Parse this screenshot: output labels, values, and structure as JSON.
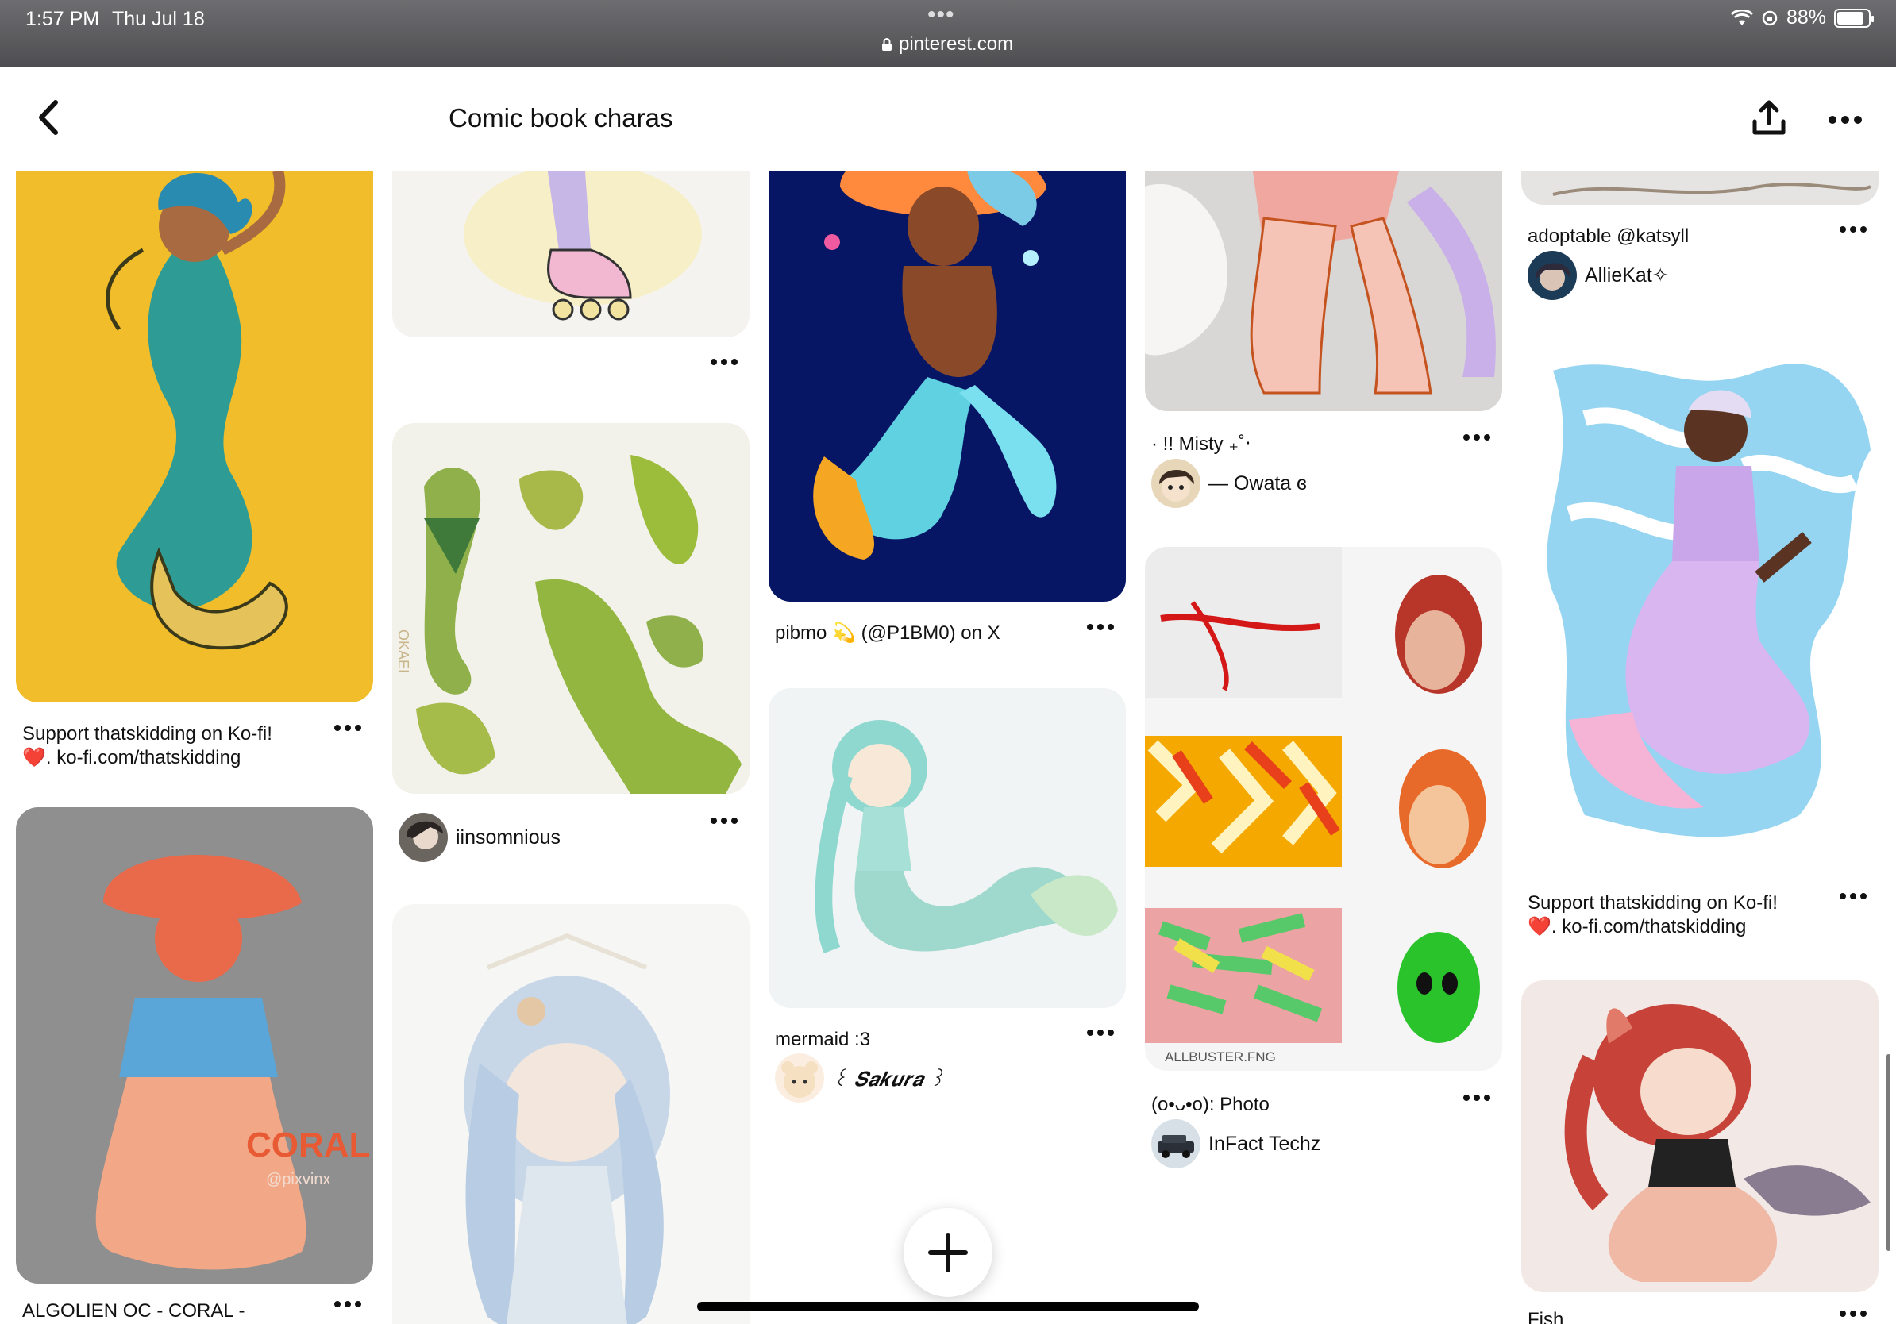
{
  "status": {
    "time": "1:57 PM",
    "date": "Thu Jul 18",
    "url": "pinterest.com",
    "battery": "88%",
    "battery_level": 0.88
  },
  "header": {
    "title": "Comic book charas"
  },
  "pins": {
    "col1": [
      {
        "title_line1": "Support thatskidding on Ko-fi!",
        "title_line2": "❤️. ko-fi.com/thatskidding"
      },
      {
        "title_line1": "ALGOLIEN OC - CORAL -",
        "image_text1": "CORAL",
        "image_text2": "@pixvinx"
      }
    ],
    "col2": [
      {
        "title_line1": ""
      },
      {
        "author": "iinsomnious",
        "image_text": "OKAEI"
      },
      {
        "title_line1": ""
      }
    ],
    "col3": [
      {
        "title_line1": "pibmo 💫 (@P1BM0) on X"
      },
      {
        "title_line1": "mermaid :3",
        "author": "꒰ 𝑺𝒂𝒌𝒖𝒓𝒂 ꒱"
      }
    ],
    "col4": [
      {
        "title_line1": "· !! Misty ₊˚‧",
        "author": "— Owata ɞ"
      },
      {
        "title_line1": "(o•ᴗ•o): Photo",
        "author": "InFact Techz",
        "image_text": "ALLBUSTER.FNG"
      }
    ],
    "col5": [
      {
        "title_line1": "adoptable @katsyll",
        "author": "AllieKat✧"
      },
      {
        "title_line1": "Support thatskidding on Ko-fi!",
        "title_line2": "❤️. ko-fi.com/thatskidding"
      },
      {
        "title_line1": "Fish"
      }
    ]
  },
  "colors": {
    "accent": "#111111",
    "status_bar": "#5b5b5e"
  }
}
